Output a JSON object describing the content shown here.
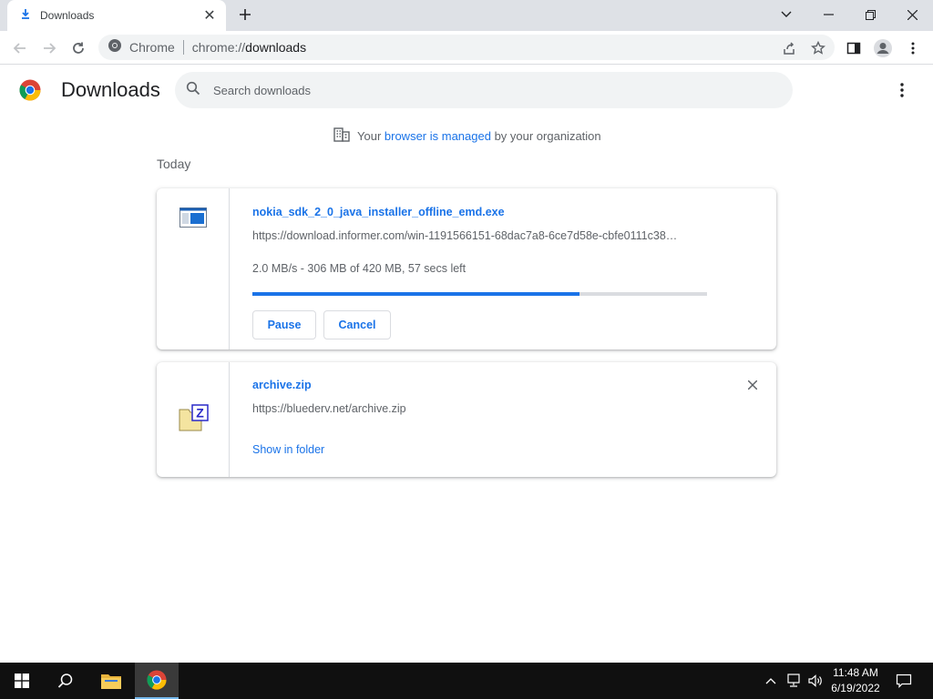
{
  "browser": {
    "tab_title": "Downloads",
    "omnibox_site": "Chrome",
    "omnibox_url_scheme": "chrome://",
    "omnibox_url_path": "downloads"
  },
  "page": {
    "title": "Downloads",
    "search_placeholder": "Search downloads",
    "managed_prefix": "Your ",
    "managed_link": "browser is managed",
    "managed_suffix": " by your organization",
    "section": "Today"
  },
  "downloads": [
    {
      "filename": "nokia_sdk_2_0_java_installer_offline_emd.exe",
      "url": "https://download.informer.com/win-1191566151-68dac7a8-6ce7d58e-cbfe0111c38…",
      "status": "2.0 MB/s - 306 MB of 420 MB, 57 secs left",
      "progress_fraction": 0.7185,
      "pause_label": "Pause",
      "cancel_label": "Cancel"
    },
    {
      "filename": "archive.zip",
      "url": "https://bluederv.net/archive.zip",
      "show_label": "Show in folder"
    }
  ],
  "taskbar": {
    "time": "11:48 AM",
    "date": "6/19/2022"
  },
  "colors": {
    "accent": "#1a73e8",
    "tabstrip": "#dee1e6",
    "taskbar": "#101010"
  }
}
